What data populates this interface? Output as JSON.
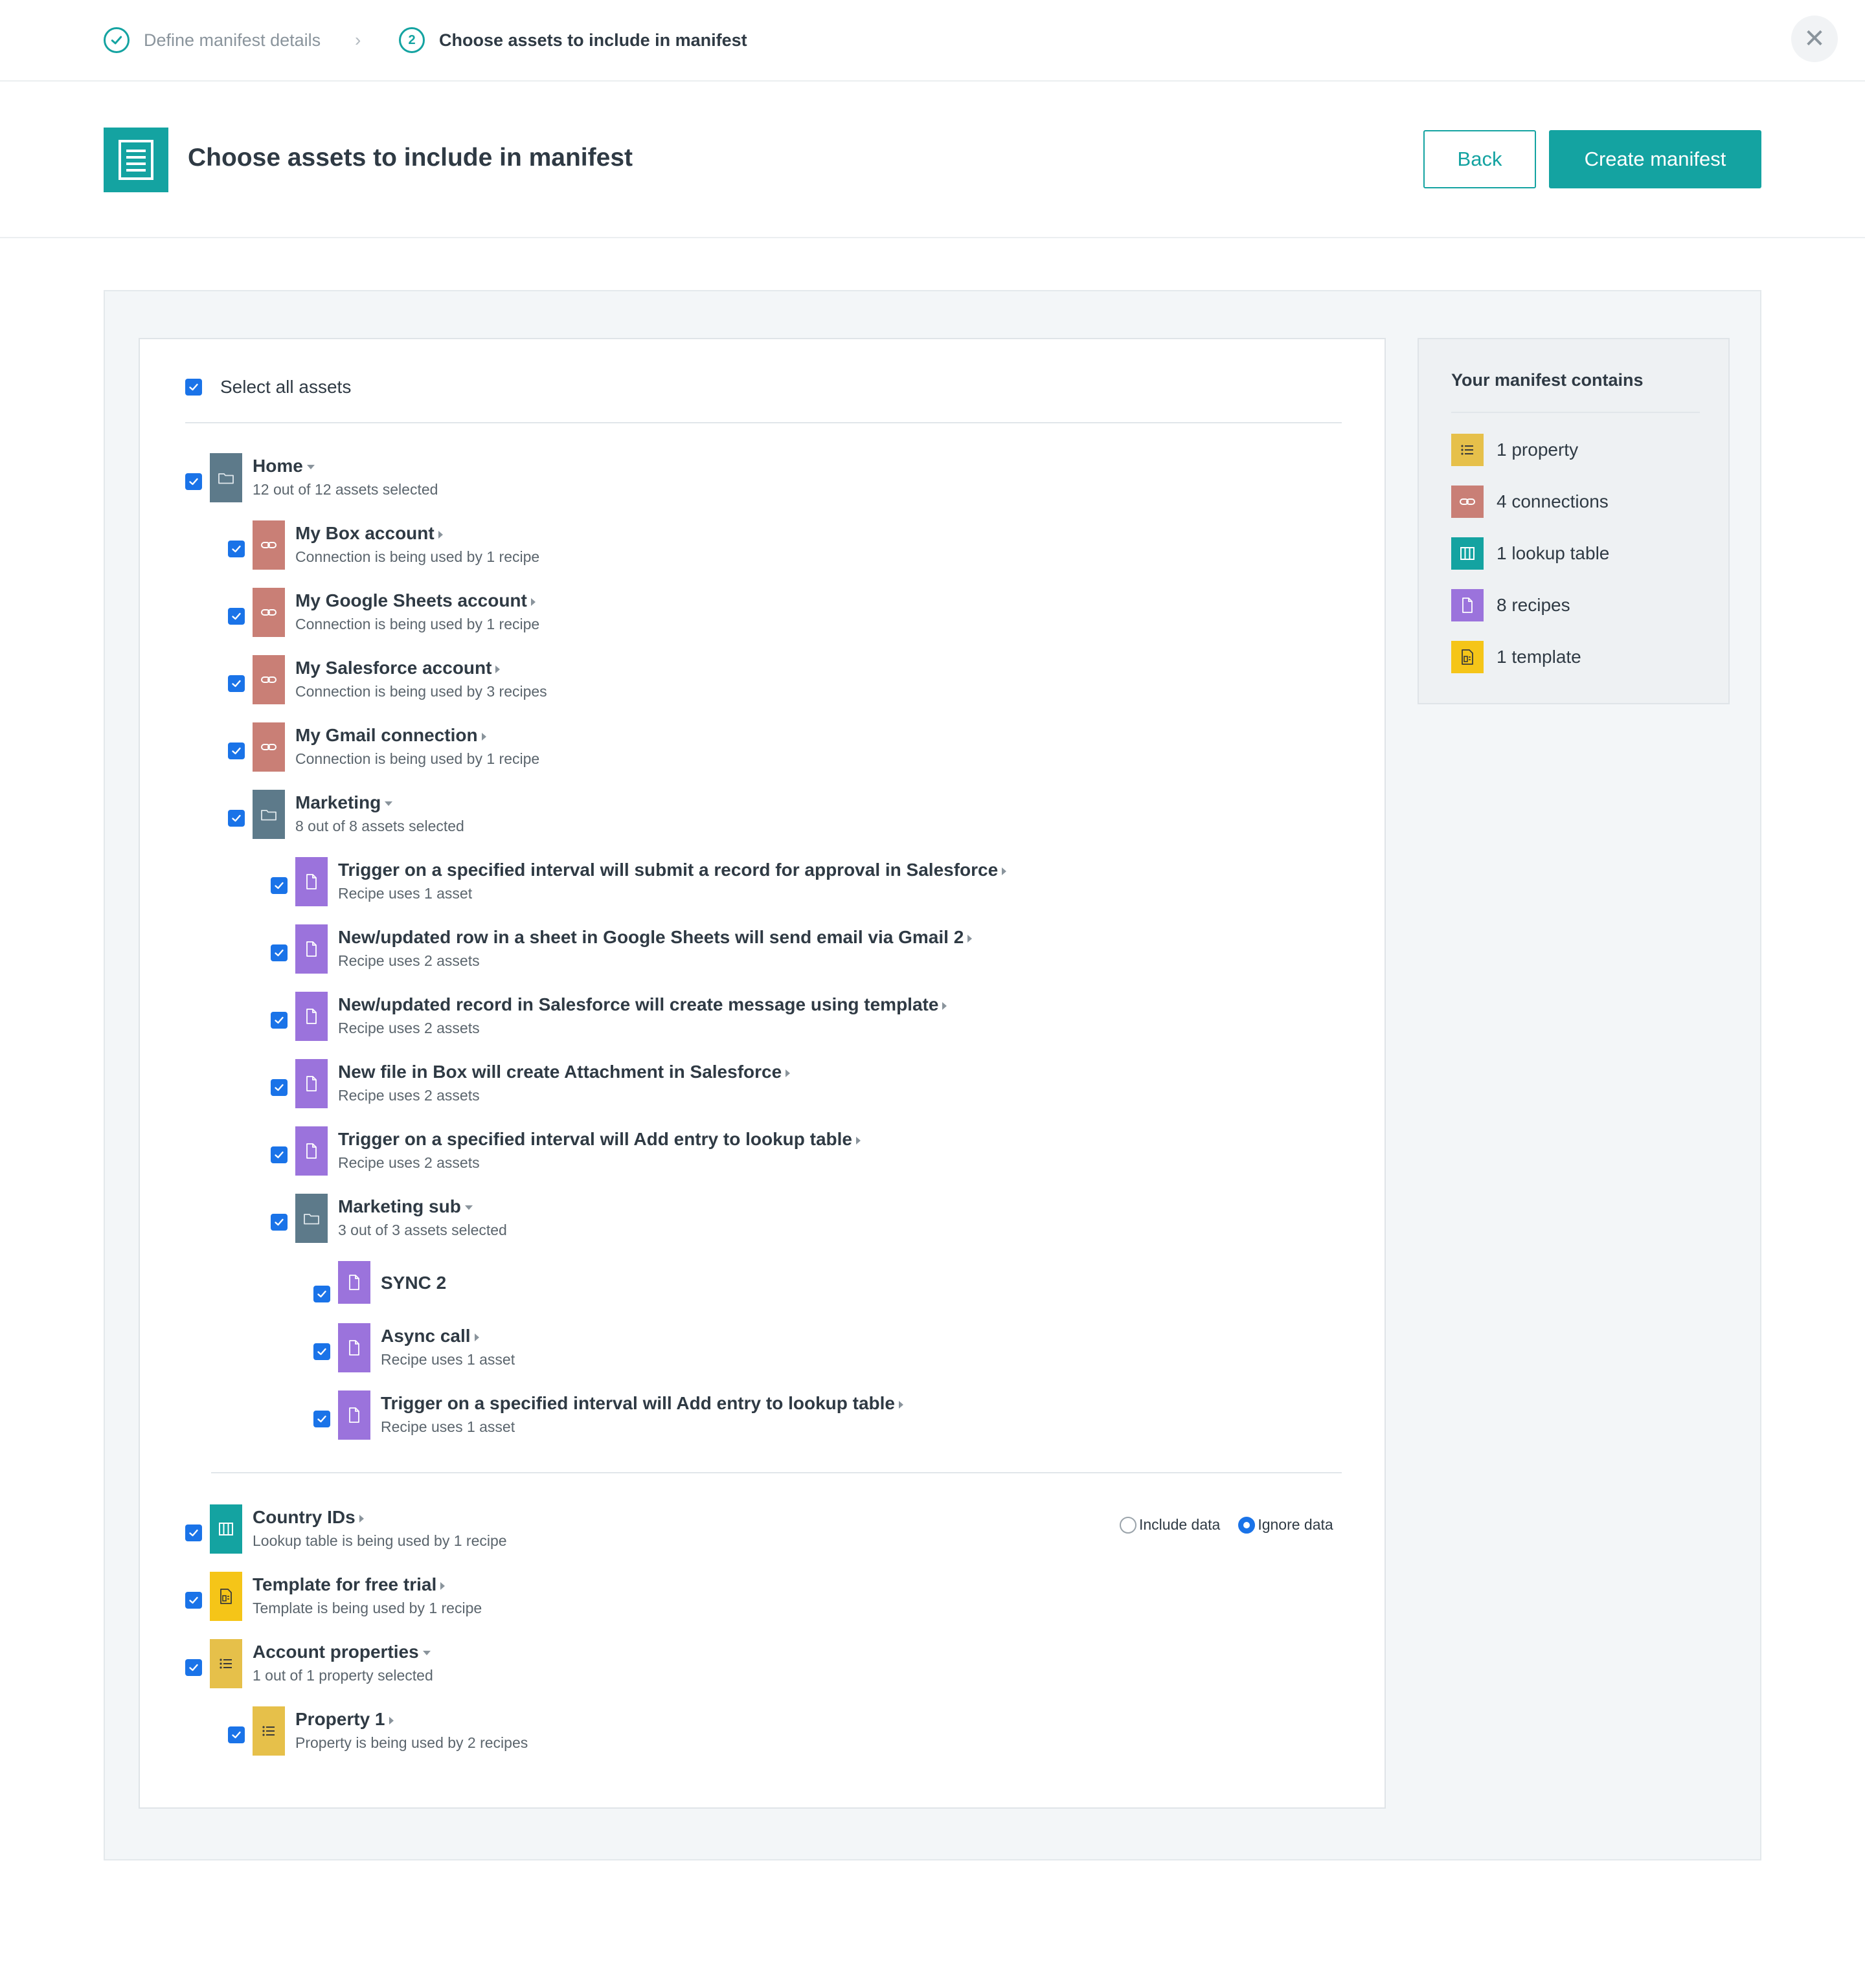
{
  "stepper": {
    "step1_label": "Define manifest details",
    "step2_number": "2",
    "step2_label": "Choose assets to include in manifest"
  },
  "header": {
    "title": "Choose assets to include in manifest",
    "back_label": "Back",
    "create_label": "Create manifest"
  },
  "select_all_label": "Select all assets",
  "tree": {
    "home": {
      "title": "Home",
      "sub": "12 out of 12 assets selected"
    },
    "box": {
      "title": "My Box account",
      "sub": "Connection is being used by 1 recipe"
    },
    "gsheets": {
      "title": "My Google Sheets account",
      "sub": "Connection is being used by 1 recipe"
    },
    "salesforce": {
      "title": "My Salesforce account",
      "sub": "Connection is being used by 3 recipes"
    },
    "gmail": {
      "title": "My Gmail connection",
      "sub": "Connection is being used by 1 recipe"
    },
    "marketing": {
      "title": "Marketing",
      "sub": "8 out of 8 assets selected"
    },
    "r1": {
      "title": "Trigger on a specified interval will submit a record for approval in Salesforce",
      "sub": "Recipe uses 1 asset"
    },
    "r2": {
      "title": "New/updated row in a sheet in Google Sheets will send email via Gmail 2",
      "sub": "Recipe uses 2 assets"
    },
    "r3": {
      "title": "New/updated record in Salesforce will create message using template",
      "sub": "Recipe uses 2 assets"
    },
    "r4": {
      "title": "New file in Box will create Attachment in Salesforce",
      "sub": "Recipe uses 2 assets"
    },
    "r5": {
      "title": "Trigger on a specified interval will Add entry to lookup table",
      "sub": "Recipe uses 2 assets"
    },
    "marketing_sub": {
      "title": "Marketing sub",
      "sub": "3 out of 3 assets selected"
    },
    "sync2": {
      "title": "SYNC 2"
    },
    "async": {
      "title": "Async call",
      "sub": "Recipe uses 1 asset"
    },
    "r6": {
      "title": "Trigger on a specified interval will Add entry to lookup table",
      "sub": "Recipe uses 1 asset"
    },
    "country": {
      "title": "Country IDs",
      "sub": "Lookup table is being used by 1 recipe"
    },
    "template": {
      "title": "Template for free trial",
      "sub": "Template is being used by 1 recipe"
    },
    "account_props": {
      "title": "Account properties",
      "sub": "1 out of 1 property selected"
    },
    "prop1": {
      "title": "Property 1",
      "sub": "Property is being used by 2 recipes"
    }
  },
  "data_options": {
    "include_label": "Include data",
    "ignore_label": "Ignore data",
    "selected": "Ignore data"
  },
  "summary": {
    "title": "Your manifest contains",
    "items": [
      {
        "label": "1 property",
        "icon": "list-icon",
        "color": "#e6c04a"
      },
      {
        "label": "4 connections",
        "icon": "link-icon",
        "color": "#c97f76"
      },
      {
        "label": "1 lookup table",
        "icon": "table-icon",
        "color": "#14a3a1"
      },
      {
        "label": "8 recipes",
        "icon": "file-icon",
        "color": "#9b73dc"
      },
      {
        "label": "1 template",
        "icon": "template-icon",
        "color": "#f5c518"
      }
    ]
  },
  "colors": {
    "accent": "#14a3a1",
    "checkbox": "#1a73e8",
    "folder": "#5d7a8a",
    "connection": "#c97f76",
    "recipe": "#9b73dc"
  }
}
